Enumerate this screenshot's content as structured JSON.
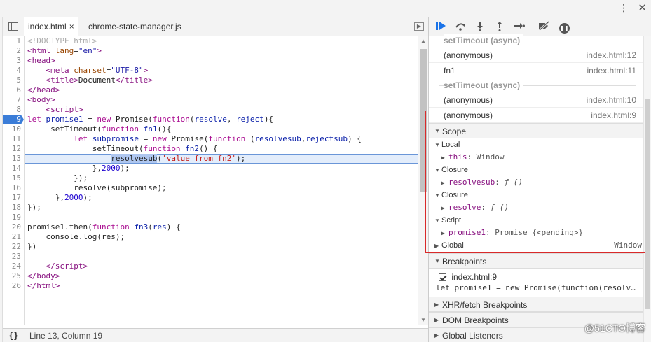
{
  "top_bar": {
    "menu_icon": "vertical-dots-icon",
    "close_icon": "close-icon",
    "menu_glyph": "⋮",
    "close_glyph": "✕"
  },
  "tabs": [
    {
      "label": "index.html",
      "active": true,
      "close": "×"
    },
    {
      "label": "chrome-state-manager.js",
      "active": false
    }
  ],
  "editor": {
    "current_line": 9,
    "highlighted_line": 13,
    "line_numbers": [
      "1",
      "2",
      "3",
      "4",
      "5",
      "6",
      "7",
      "8",
      "9",
      "10",
      "11",
      "12",
      "13",
      "14",
      "15",
      "16",
      "17",
      "18",
      "19",
      "20",
      "21",
      "22",
      "23",
      "24",
      "25",
      "26"
    ]
  },
  "status_bar": {
    "braces": "{}",
    "position": "Line 13, Column 19"
  },
  "debugger_toolbar": {
    "resume": "resume-icon",
    "step_over": "step-over-icon",
    "step_into": "step-into-icon",
    "step_out": "step-out-icon",
    "step": "step-icon",
    "deactivate": "deactivate-breakpoints-icon",
    "pause_exceptions": "pause-on-exceptions-icon"
  },
  "call_stack": [
    {
      "type": "async",
      "label": "setTimeout (async)"
    },
    {
      "type": "frame",
      "fn": "(anonymous)",
      "loc": "index.html:12"
    },
    {
      "type": "frame",
      "fn": "fn1",
      "loc": "index.html:11"
    },
    {
      "type": "async",
      "label": "setTimeout (async)"
    },
    {
      "type": "frame",
      "fn": "(anonymous)",
      "loc": "index.html:10"
    },
    {
      "type": "frame",
      "fn": "(anonymous)",
      "loc": "index.html:9"
    }
  ],
  "scope": {
    "header": "Scope",
    "local": {
      "label": "Local",
      "this_key": "this",
      "this_val": "Window"
    },
    "closure1": {
      "label": "Closure",
      "key": "resolvesub",
      "val": "ƒ ()"
    },
    "closure2": {
      "label": "Closure",
      "key": "resolve",
      "val": "ƒ ()"
    },
    "script": {
      "label": "Script",
      "key": "promise1",
      "val": "Promise {<pending>}"
    },
    "global": {
      "label": "Global",
      "val": "Window"
    }
  },
  "breakpoints": {
    "header": "Breakpoints",
    "item_label": "index.html:9",
    "item_code": "let promise1 = new Promise(function(resolv…"
  },
  "sections": {
    "xhr": "XHR/fetch Breakpoints",
    "dom": "DOM Breakpoints",
    "global_listeners": "Global Listeners"
  },
  "watermark": "@51CTO博客"
}
